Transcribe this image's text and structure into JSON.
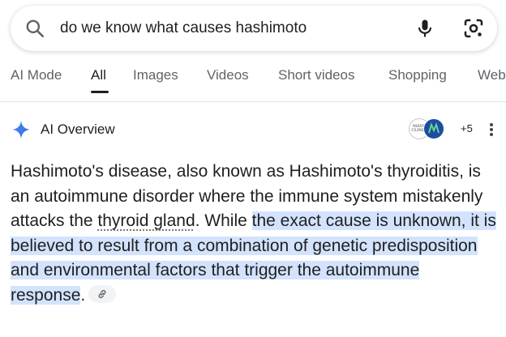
{
  "search": {
    "query": "do we know what causes hashimoto"
  },
  "tabs": [
    "AI Mode",
    "All",
    "Images",
    "Videos",
    "Short videos",
    "Shopping",
    "Web"
  ],
  "active_tab": "All",
  "ai_overview": {
    "title": "AI Overview",
    "sources_more": "+5",
    "source_logo_text": "MAYO CLINIC",
    "text_plain_1": "Hashimoto's disease, also known as Hashimoto's thyroiditis, is an autoimmune disorder where the immune system mistakenly attacks the ",
    "text_link": "thyroid gland",
    "text_plain_2": ". While ",
    "text_highlight": "the exact cause is unknown, it is believed to result from a combination of genetic predisposition and environmental factors that trigger the autoimmune response",
    "text_end": "."
  },
  "colors": {
    "highlight": "#d3e3fd",
    "accent": "#4285f4"
  }
}
